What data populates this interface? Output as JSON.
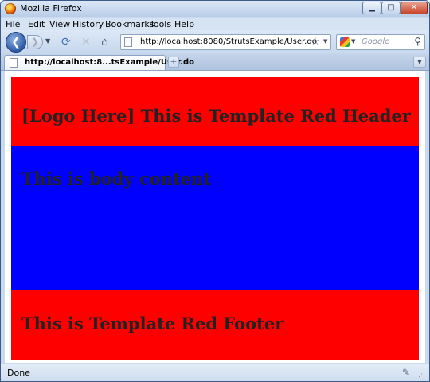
{
  "window": {
    "title": "Mozilla Firefox",
    "buttons": {
      "minimize": "▁",
      "maximize": "□",
      "close": "✕"
    }
  },
  "menu": {
    "items": [
      {
        "label": "File"
      },
      {
        "label": "Edit"
      },
      {
        "label": "View"
      },
      {
        "label": "History"
      },
      {
        "label": "Bookmarks"
      },
      {
        "label": "Tools"
      },
      {
        "label": "Help"
      }
    ]
  },
  "toolbar": {
    "back_glyph": "❮",
    "forward_glyph": "❯",
    "dropdown_glyph": "▼",
    "reload_glyph": "⟳",
    "stop_glyph": "✕",
    "home_glyph": "⌂",
    "url": "http://localhost:8080/StrutsExample/User.do",
    "bookmark_glyph": "☆",
    "search_placeholder": "Google",
    "search_glyph": "⚲"
  },
  "tabs": {
    "items": [
      {
        "title": "http://localhost:8...tsExample/User.do"
      }
    ],
    "new_tab_glyph": "+",
    "tab_list_glyph": "▼"
  },
  "page": {
    "header": "[Logo Here] This is Template Red Header",
    "body": "This is body content",
    "footer": "This is Template Red Footer",
    "colors": {
      "header_bg": "#ff0000",
      "body_bg": "#0000ff",
      "footer_bg": "#ff0000"
    }
  },
  "status": {
    "text": "Done",
    "addon_glyph": "✎",
    "grip_glyph": "⋰"
  }
}
